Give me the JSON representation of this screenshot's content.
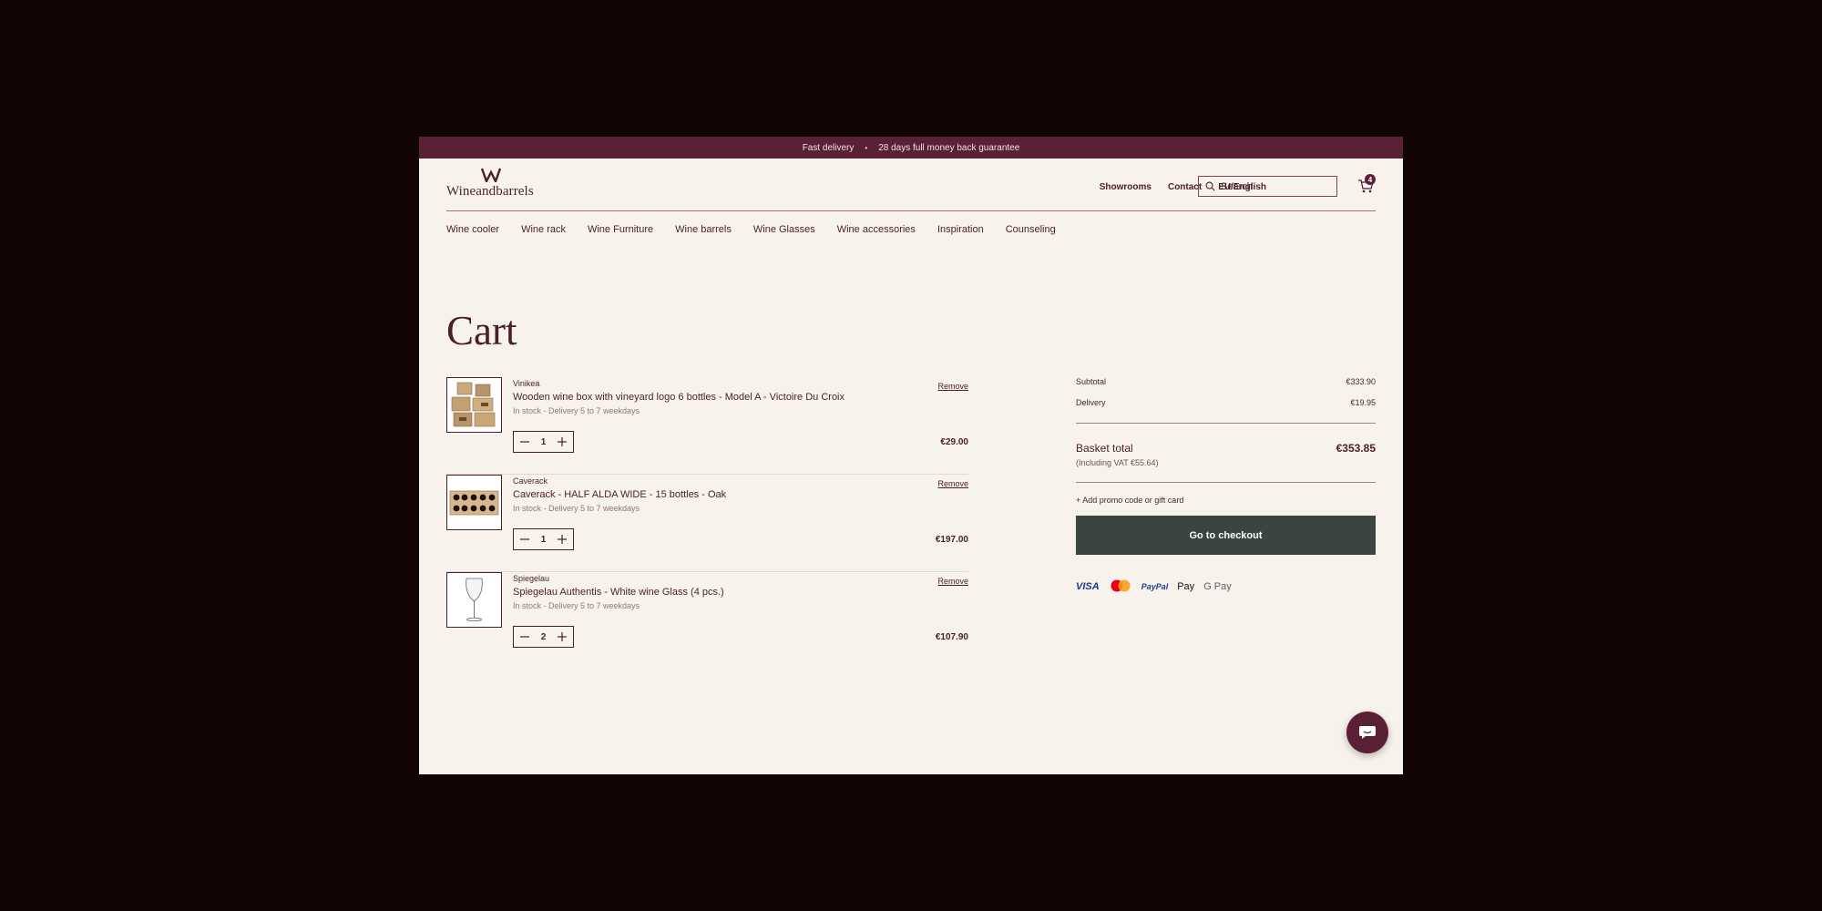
{
  "announcement": {
    "left": "Fast delivery",
    "separator": "•",
    "right": "28 days full money back guarantee"
  },
  "header": {
    "logo_text": "Wineandbarrels",
    "links": [
      "Showrooms",
      "Contact",
      "EU/English"
    ],
    "search_placeholder": "Search",
    "cart_count": "4"
  },
  "nav": [
    "Wine cooler",
    "Wine rack",
    "Wine Furniture",
    "Wine barrels",
    "Wine Glasses",
    "Wine accessories",
    "Inspiration",
    "Counseling"
  ],
  "page_title": "Cart",
  "cart_items": [
    {
      "brand": "Vinikea",
      "name": "Wooden wine box with vineyard logo 6 bottles - Model A - Victoire Du Croix",
      "stock": "In stock - Delivery 5 to 7 weekdays",
      "remove": "Remove",
      "qty": "1",
      "price": "€29.00",
      "image_icon": "wine-box-image"
    },
    {
      "brand": "Caverack",
      "name": "Caverack - HALF ALDA WIDE - 15 bottles - Oak",
      "stock": "In stock - Delivery 5 to 7 weekdays",
      "remove": "Remove",
      "qty": "1",
      "price": "€197.00",
      "image_icon": "wine-rack-image"
    },
    {
      "brand": "Spiegelau",
      "name": "Spiegelau Authentis - White wine Glass (4 pcs.)",
      "stock": "In stock - Delivery 5 to 7 weekdays",
      "remove": "Remove",
      "qty": "2",
      "price": "€107.90",
      "image_icon": "wine-glass-image"
    }
  ],
  "summary": {
    "subtotal_label": "Subtotal",
    "subtotal_value": "€333.90",
    "delivery_label": "Delivery",
    "delivery_value": "€19.95",
    "total_label": "Basket total",
    "total_value": "€353.85",
    "vat_note": "(Including VAT €55.64)",
    "promo_link": "+ Add promo code or gift card",
    "checkout_label": "Go to checkout",
    "payment_methods": [
      "VISA",
      "Mastercard",
      "PayPal",
      " Pay",
      "G Pay"
    ]
  },
  "colors": {
    "brand": "#5a2036",
    "background": "#f7f2ec",
    "checkout": "#3a4440",
    "text": "#4a1e2a"
  }
}
